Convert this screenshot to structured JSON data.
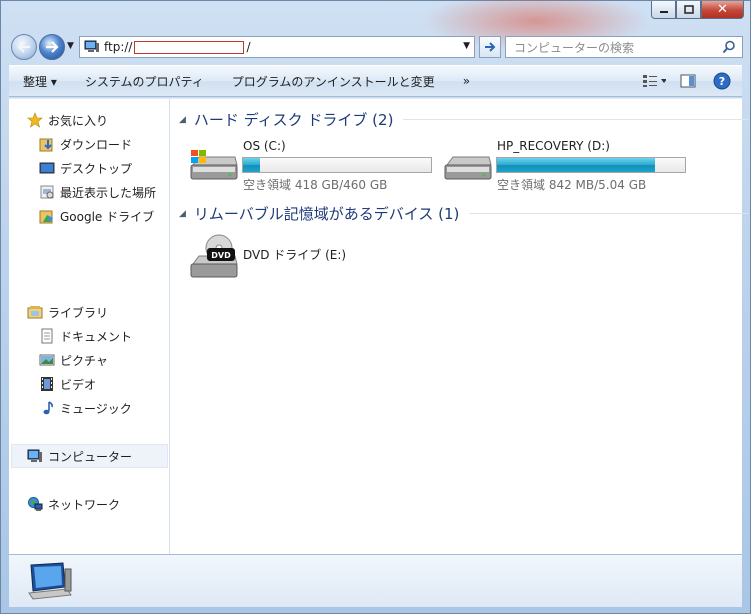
{
  "address": {
    "prefix": "ftp://",
    "suffix": "/"
  },
  "search": {
    "placeholder": "コンピューターの検索"
  },
  "toolbar": {
    "organize": "整理 ▾",
    "system_properties": "システムのプロパティ",
    "uninstall": "プログラムのアンインストールと変更",
    "more": "»"
  },
  "sidebar": {
    "favorites": "お気に入り",
    "downloads": "ダウンロード",
    "desktop": "デスクトップ",
    "recent": "最近表示した場所",
    "google_drive": "Google ドライブ",
    "libraries": "ライブラリ",
    "documents": "ドキュメント",
    "pictures": "ピクチャ",
    "videos": "ビデオ",
    "music": "ミュージック",
    "computer": "コンピューター",
    "network": "ネットワーク"
  },
  "groups": {
    "hdd": "ハード ディスク ドライブ (2)",
    "removable": "リムーバブル記憶域があるデバイス (1)"
  },
  "drives": [
    {
      "name": "OS (C:)",
      "free_text": "空き領域 418 GB/460 GB",
      "used_fraction": 0.09
    },
    {
      "name": "HP_RECOVERY (D:)",
      "free_text": "空き領域 842 MB/5.04 GB",
      "used_fraction": 0.84
    }
  ],
  "dvd": {
    "name": "DVD ドライブ (E:)",
    "badge": "DVD"
  }
}
